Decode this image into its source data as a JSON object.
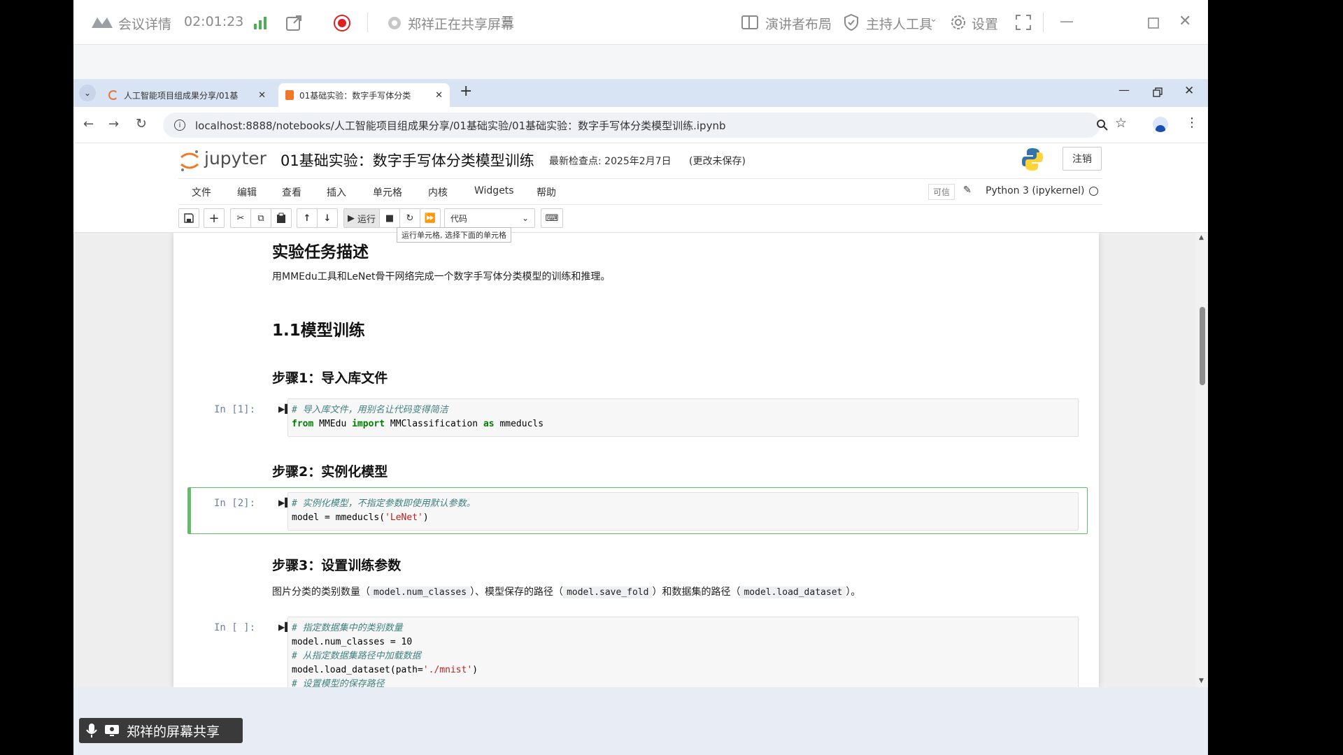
{
  "meeting": {
    "details_label": "会议详情",
    "timer": "02:01:23",
    "sharing_status": "郑祥正在共享屏幕",
    "presenter_layout": "演讲者布局",
    "host_tools": "主持人工具",
    "settings": "设置",
    "share_badge": "郑祥的屏幕共享",
    "record_color": "#e02020"
  },
  "browser": {
    "tabs": [
      {
        "label": "人工智能项目组成果分享/01基"
      },
      {
        "label": "01基础实验：数字手写体分类"
      }
    ],
    "url": "localhost:8888/notebooks/人工智能项目组成果分享/01基础实验/01基础实验：数字手写体分类模型训练.ipynb"
  },
  "jupyter": {
    "logo_text": "jupyter",
    "notebook_title": "01基础实验：数字手写体分类模型训练",
    "checkpoint": "最新检查点: 2025年2月7日",
    "unsaved": "(更改未保存)",
    "logout": "注销",
    "menu": [
      "文件",
      "编辑",
      "查看",
      "插入",
      "单元格",
      "内核",
      "Widgets",
      "帮助"
    ],
    "trusted": "可信",
    "kernel": "Python 3 (ipykernel)",
    "run_label": "运行",
    "cell_type": "代码",
    "tooltip": "运行单元格, 选择下面的单元格",
    "accent": "#f37726",
    "selected_cell_color": "#66bb6a"
  },
  "notebook": {
    "heading": "实验任务描述",
    "intro": "用MMEdu工具和LeNet骨干网络完成一个数字手写体分类模型的训练和推理。",
    "section": "1.1模型训练",
    "step1": "步骤1：导入库文件",
    "step2": "步骤2：实例化模型",
    "step3": "步骤3：设置训练参数",
    "step3_desc": {
      "pre": "图片分类的类别数量（",
      "c1": "model.num_classes",
      "mid1": "）、模型保存的路径（",
      "c2": "model.save_fold",
      "mid2": "）和数据集的路径（",
      "c3": "model.load_dataset",
      "post": "）。"
    },
    "cells": [
      {
        "prompt": "In  [1]:",
        "lines": [
          {
            "comment": "# 导入库文件，用别名让代码变得简洁"
          },
          {
            "kw1": "from",
            "t1": " MMEdu ",
            "kw2": "import",
            "t2": " MMClassification ",
            "kw3": "as",
            "t3": " mmeducls"
          }
        ]
      },
      {
        "prompt": "In  [2]:",
        "lines": [
          {
            "comment": "# 实例化模型，不指定参数即使用默认参数。"
          },
          {
            "t1": "model = mmeducls(",
            "str": "'LeNet'",
            "t2": ")"
          }
        ]
      },
      {
        "prompt": "In  [ ]:",
        "lines": [
          {
            "comment": "# 指定数据集中的类别数量"
          },
          {
            "t1": "model.num_classes = 10"
          },
          {
            "comment": "# 从指定数据集路径中加载数据"
          },
          {
            "t1": "model.load_dataset(path=",
            "str": "'./mnist'",
            "t2": ")"
          },
          {
            "comment": "# 设置模型的保存路径"
          }
        ]
      }
    ]
  }
}
